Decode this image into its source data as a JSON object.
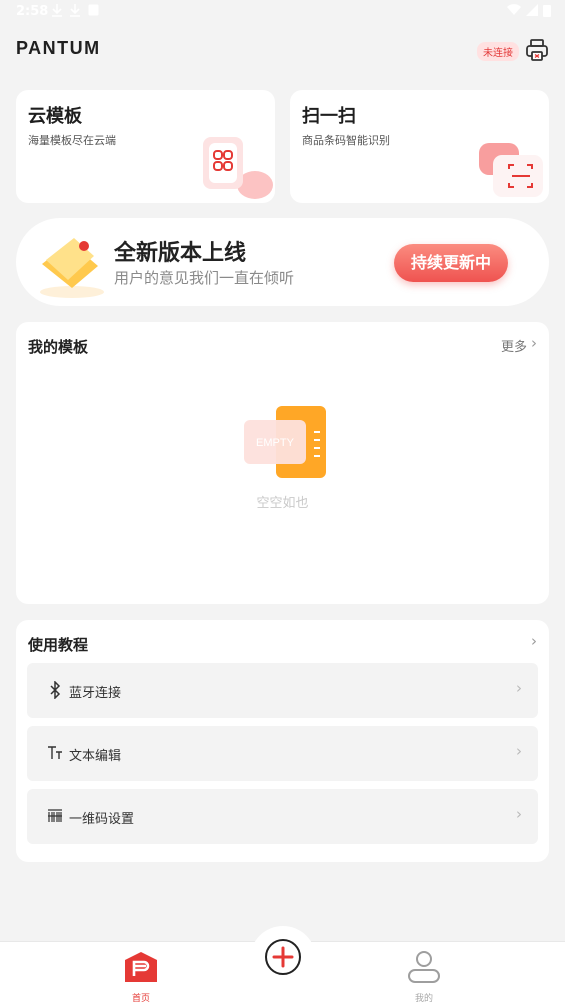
{
  "status_bar": {
    "time": "2:58"
  },
  "header": {
    "logo": "PANTUM",
    "connection_status": "未连接"
  },
  "quick_actions": [
    {
      "title": "云模板",
      "subtitle": "海量模板尽在云端",
      "icon": "grid-cloud-icon"
    },
    {
      "title": "扫一扫",
      "subtitle": "商品条码智能识别",
      "icon": "scan-icon"
    }
  ],
  "banner": {
    "title": "全新版本上线",
    "subtitle": "用户的意见我们一直在倾听",
    "button": "持续更新中"
  },
  "my_templates": {
    "title": "我的模板",
    "more": "更多",
    "empty_badge": "EMPTY",
    "empty_text": "空空如也"
  },
  "tutorials": {
    "title": "使用教程",
    "items": [
      {
        "label": "蓝牙连接",
        "icon": "bluetooth-icon"
      },
      {
        "label": "文本编辑",
        "icon": "text-icon"
      },
      {
        "label": "一维码设置",
        "icon": "barcode-icon"
      }
    ]
  },
  "tabbar": {
    "home": "首页",
    "mine": "我的"
  },
  "colors": {
    "accent": "#e53935",
    "background": "#f3f3f3",
    "card": "#ffffff"
  }
}
